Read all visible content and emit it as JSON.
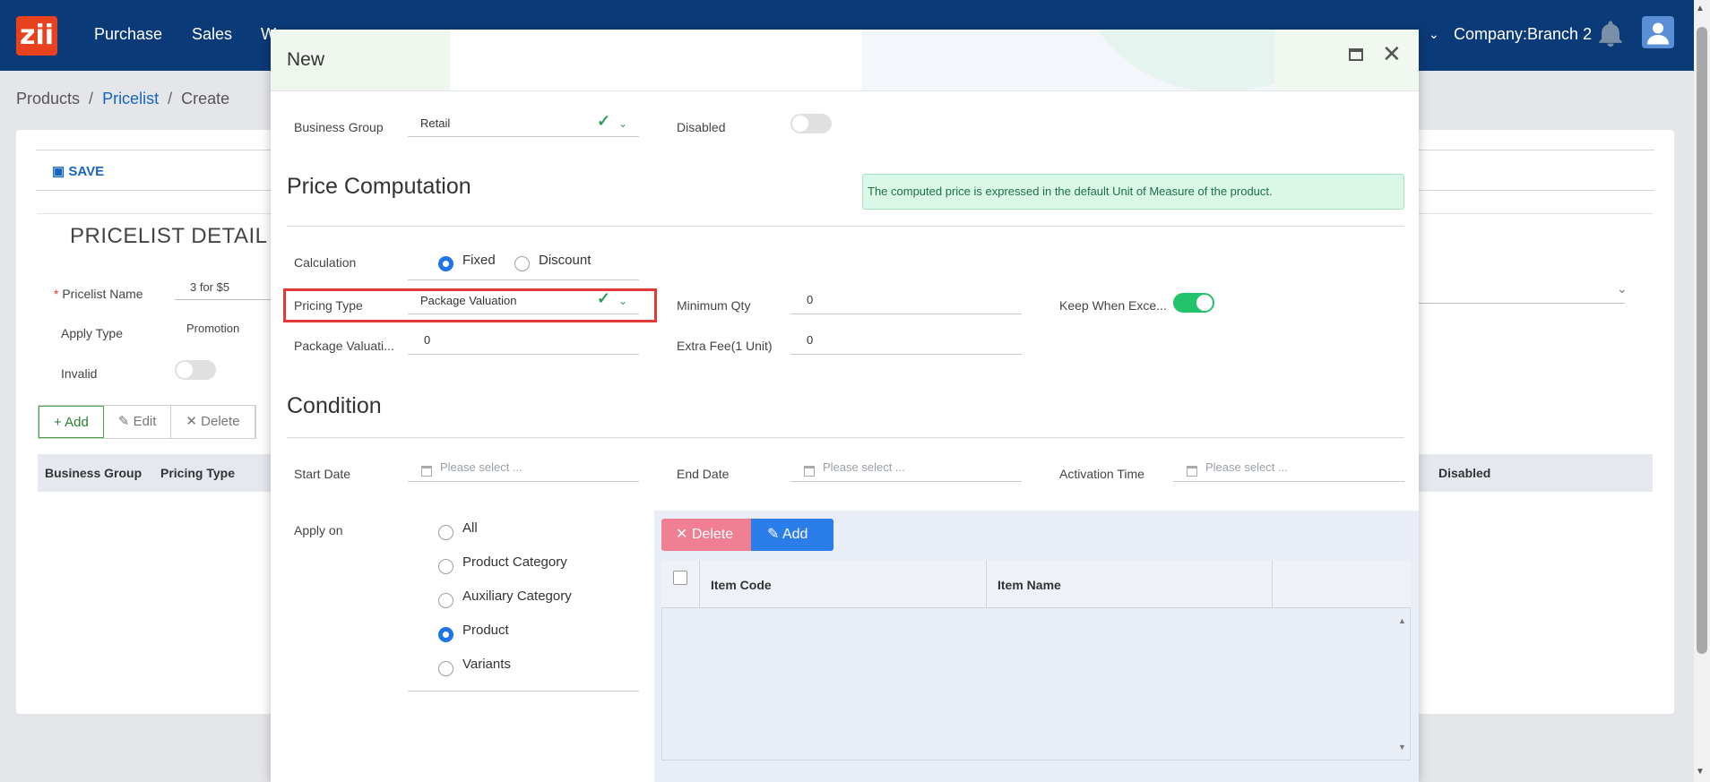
{
  "app": {
    "logo_text": "zii",
    "nav": [
      "Purchase",
      "Sales",
      "W"
    ],
    "company": "Company:Branch 2"
  },
  "breadcrumb": {
    "items": [
      "Products",
      "Pricelist",
      "Create"
    ]
  },
  "background": {
    "save_label": "SAVE",
    "title": "PRICELIST DETAIL",
    "fields": {
      "pricelist_name_label": "Pricelist Name",
      "pricelist_name_value": "3 for $5",
      "apply_type_label": "Apply Type",
      "apply_type_value": "Promotion",
      "invalid_label": "Invalid"
    },
    "buttons": {
      "add": "Add",
      "edit": "Edit",
      "delete": "Delete"
    },
    "columns": {
      "business_group": "Business Group",
      "pricing_type": "Pricing Type",
      "disabled": "Disabled"
    }
  },
  "modal": {
    "title": "New",
    "business_group": {
      "label": "Business Group",
      "value": "Retail"
    },
    "disabled": {
      "label": "Disabled",
      "on": false
    },
    "price_computation": {
      "title": "Price Computation",
      "info": "The computed price is expressed in the default Unit of Measure of the product.",
      "calculation": {
        "label": "Calculation",
        "options": [
          "Fixed",
          "Discount"
        ],
        "selected": "Fixed"
      },
      "pricing_type": {
        "label": "Pricing Type",
        "value": "Package Valuation"
      },
      "minimum_qty": {
        "label": "Minimum Qty",
        "value": "0"
      },
      "keep_when_exceed": {
        "label": "Keep When Exce...",
        "on": true
      },
      "package_valuation": {
        "label": "Package Valuati...",
        "value": "0"
      },
      "extra_fee": {
        "label": "Extra Fee(1 Unit)",
        "value": "0"
      }
    },
    "condition": {
      "title": "Condition",
      "start_date": {
        "label": "Start Date",
        "placeholder": "Please select ..."
      },
      "end_date": {
        "label": "End Date",
        "placeholder": "Please select ..."
      },
      "activation_time": {
        "label": "Activation Time",
        "placeholder": "Please select ..."
      },
      "apply_on": {
        "label": "Apply on",
        "options": [
          "All",
          "Product Category",
          "Auxiliary Category",
          "Product",
          "Variants"
        ],
        "selected": "Product"
      },
      "grid": {
        "delete_label": "Delete",
        "add_label": "Add",
        "columns": [
          "Item Code",
          "Item Name"
        ]
      }
    }
  },
  "colors": {
    "nav": "#0b3a78",
    "accent": "#1e74e8",
    "success": "#22c36a",
    "danger": "#f07f93",
    "highlight": "#e53935"
  }
}
